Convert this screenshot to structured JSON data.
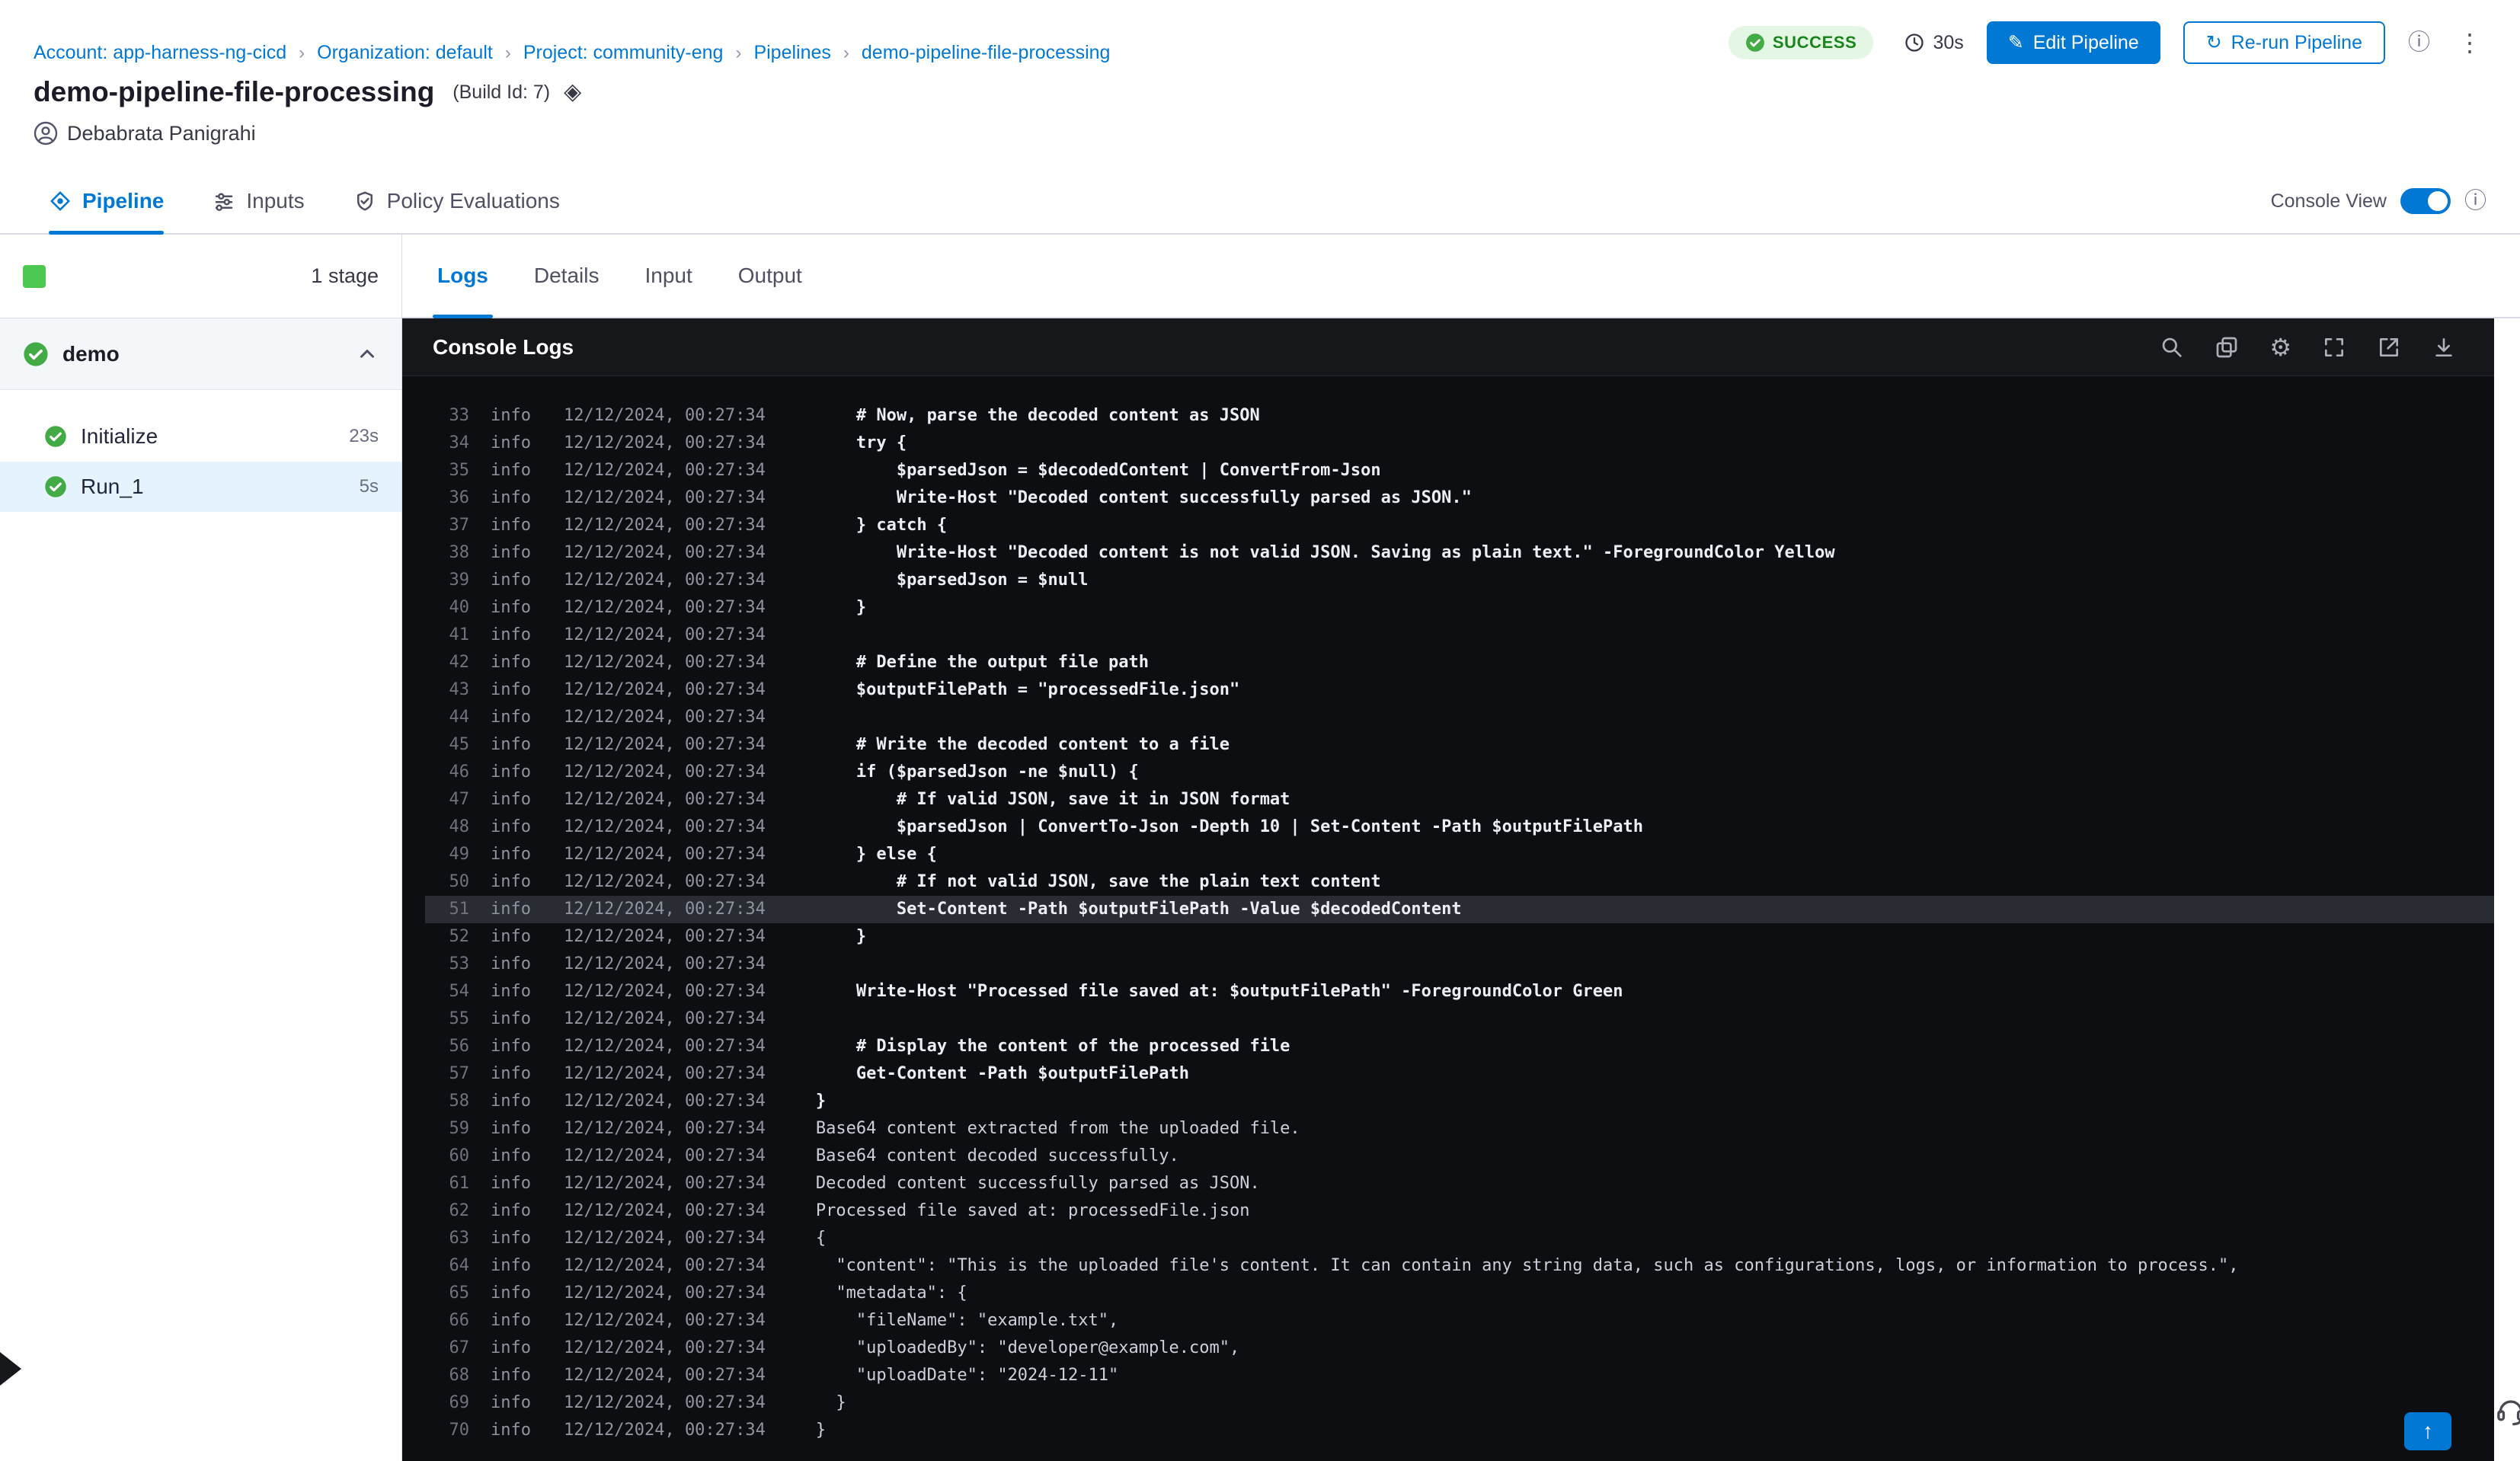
{
  "colors": {
    "primary": "#0278d5",
    "success_icon": "#42ab45",
    "success_badge_bg": "#e4f7e5",
    "success_badge_text": "#1b841d",
    "console_bg": "#0d0e11",
    "highlight_row": "#2a2c33",
    "selected_step_bg": "#e4f3fd"
  },
  "breadcrumb": {
    "separator": "›",
    "items": [
      "Account: app-harness-ng-cicd",
      "Organization: default",
      "Project: community-eng",
      "Pipelines",
      "demo-pipeline-file-processing"
    ]
  },
  "header": {
    "status": "SUCCESS",
    "duration": "30s",
    "edit_button": "Edit Pipeline",
    "rerun_button": "Re-run Pipeline",
    "title": "demo-pipeline-file-processing",
    "build_id": "(Build Id: 7)",
    "author": "Debabrata Panigrahi"
  },
  "main_tabs": {
    "pipeline": "Pipeline",
    "inputs": "Inputs",
    "policy": "Policy Evaluations",
    "console_view_label": "Console View",
    "console_view_on": true
  },
  "sidebar": {
    "stage_count": "1 stage",
    "group_label": "demo",
    "steps": [
      {
        "label": "Initialize",
        "duration": "23s"
      },
      {
        "label": "Run_1",
        "duration": "5s",
        "selected": true
      }
    ]
  },
  "console": {
    "tabs": [
      "Logs",
      "Details",
      "Input",
      "Output"
    ],
    "active_tab": "Logs",
    "title": "Console Logs",
    "level": "info",
    "timestamp": "12/12/2024, 00:27:34",
    "lines": [
      {
        "n": 33,
        "kind": "script",
        "text": "    # Now, parse the decoded content as JSON"
      },
      {
        "n": 34,
        "kind": "script",
        "text": "    try {"
      },
      {
        "n": 35,
        "kind": "script",
        "text": "        $parsedJson = $decodedContent | ConvertFrom-Json"
      },
      {
        "n": 36,
        "kind": "script",
        "text": "        Write-Host \"Decoded content successfully parsed as JSON.\""
      },
      {
        "n": 37,
        "kind": "script",
        "text": "    } catch {"
      },
      {
        "n": 38,
        "kind": "script",
        "text": "        Write-Host \"Decoded content is not valid JSON. Saving as plain text.\" -ForegroundColor Yellow"
      },
      {
        "n": 39,
        "kind": "script",
        "text": "        $parsedJson = $null"
      },
      {
        "n": 40,
        "kind": "script",
        "text": "    }"
      },
      {
        "n": 41,
        "kind": "script",
        "text": ""
      },
      {
        "n": 42,
        "kind": "script",
        "text": "    # Define the output file path"
      },
      {
        "n": 43,
        "kind": "script",
        "text": "    $outputFilePath = \"processedFile.json\""
      },
      {
        "n": 44,
        "kind": "script",
        "text": ""
      },
      {
        "n": 45,
        "kind": "script",
        "text": "    # Write the decoded content to a file"
      },
      {
        "n": 46,
        "kind": "script",
        "text": "    if ($parsedJson -ne $null) {"
      },
      {
        "n": 47,
        "kind": "script",
        "text": "        # If valid JSON, save it in JSON format"
      },
      {
        "n": 48,
        "kind": "script",
        "text": "        $parsedJson | ConvertTo-Json -Depth 10 | Set-Content -Path $outputFilePath"
      },
      {
        "n": 49,
        "kind": "script",
        "text": "    } else {"
      },
      {
        "n": 50,
        "kind": "script",
        "text": "        # If not valid JSON, save the plain text content"
      },
      {
        "n": 51,
        "kind": "script",
        "text": "        Set-Content -Path $outputFilePath -Value $decodedContent",
        "highlight": true
      },
      {
        "n": 52,
        "kind": "script",
        "text": "    }"
      },
      {
        "n": 53,
        "kind": "script",
        "text": ""
      },
      {
        "n": 54,
        "kind": "script",
        "text": "    Write-Host \"Processed file saved at: $outputFilePath\" -ForegroundColor Green"
      },
      {
        "n": 55,
        "kind": "script",
        "text": ""
      },
      {
        "n": 56,
        "kind": "script",
        "text": "    # Display the content of the processed file"
      },
      {
        "n": 57,
        "kind": "script",
        "text": "    Get-Content -Path $outputFilePath"
      },
      {
        "n": 58,
        "kind": "script",
        "text": "}"
      },
      {
        "n": 59,
        "kind": "out",
        "text": "Base64 content extracted from the uploaded file."
      },
      {
        "n": 60,
        "kind": "out",
        "text": "Base64 content decoded successfully."
      },
      {
        "n": 61,
        "kind": "out",
        "text": "Decoded content successfully parsed as JSON."
      },
      {
        "n": 62,
        "kind": "out",
        "text": "Processed file saved at: processedFile.json"
      },
      {
        "n": 63,
        "kind": "out",
        "text": "{"
      },
      {
        "n": 64,
        "kind": "out",
        "text": "  \"content\": \"This is the uploaded file's content. It can contain any string data, such as configurations, logs, or information to process.\","
      },
      {
        "n": 65,
        "kind": "out",
        "text": "  \"metadata\": {"
      },
      {
        "n": 66,
        "kind": "out",
        "text": "    \"fileName\": \"example.txt\","
      },
      {
        "n": 67,
        "kind": "out",
        "text": "    \"uploadedBy\": \"developer@example.com\","
      },
      {
        "n": 68,
        "kind": "out",
        "text": "    \"uploadDate\": \"2024-12-11\""
      },
      {
        "n": 69,
        "kind": "out",
        "text": "  }"
      },
      {
        "n": 70,
        "kind": "out",
        "text": "}"
      }
    ]
  },
  "icons": {
    "edit": "✎",
    "rerun": "↻",
    "info": "ⓘ",
    "kebab": "⋮",
    "build": "◈",
    "settings": "⚙",
    "scroll_top": "↑"
  }
}
